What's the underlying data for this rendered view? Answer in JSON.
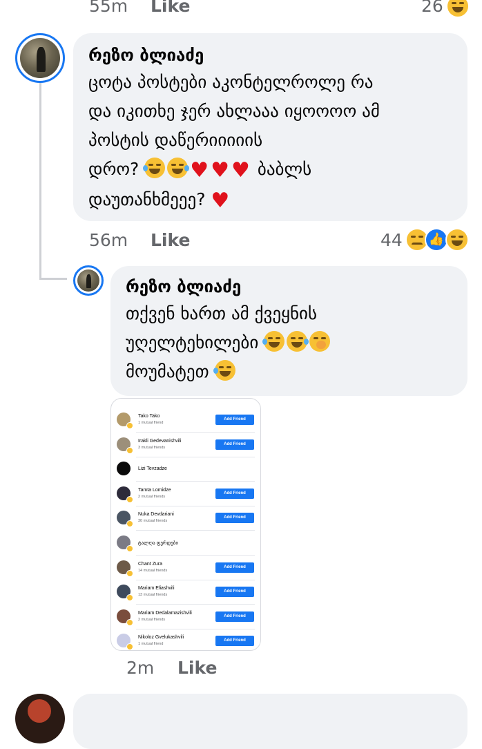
{
  "top_meta": {
    "time": "55m",
    "like": "Like",
    "reaction_count": "26"
  },
  "comment1": {
    "author": "რეზო ბლიაძე",
    "lines": [
      "ცოტა პოსტები აკონტელროლე რა",
      "და იკითხე ჯერ ახლააა იყოოოო ამ",
      "პოსტის დაწერიიიიის"
    ],
    "line4_start": "დრო?",
    "line4_end": "ბაბლს",
    "line5": "დაუთანხმეეე?",
    "time": "56m",
    "like": "Like",
    "reaction_count": "44"
  },
  "reply": {
    "author": "რეზო ბლიაძე",
    "line1": "თქვენ ხართ ამ ქვეყნის",
    "line2": "უღელტეხილები",
    "line3": "მოუმატეთ",
    "time": "2m",
    "like": "Like"
  },
  "friend_list": {
    "button_label": "Add Friend",
    "rows": [
      {
        "name": "Tako Tako",
        "mutual": "1 mutual friend",
        "has_button": true
      },
      {
        "name": "Irakli Gedevanishvili",
        "mutual": "3 mutual friends",
        "has_button": true
      },
      {
        "name": "Lizi Tevzadze",
        "mutual": "",
        "has_button": false
      },
      {
        "name": "Tamta Lomidze",
        "mutual": "2 mutual friends",
        "has_button": true
      },
      {
        "name": "Nuka Devdariani",
        "mutual": "30 mutual friends",
        "has_button": true
      },
      {
        "name": "ტალღა ფერდები",
        "mutual": "",
        "has_button": false
      },
      {
        "name": "Chant Zura",
        "mutual": "14 mutual friends",
        "has_button": true
      },
      {
        "name": "Mariam Eliashvili",
        "mutual": "13 mutual friends",
        "has_button": true
      },
      {
        "name": "Mariam Dedalamazishvili",
        "mutual": "2 mutual friends",
        "has_button": true
      },
      {
        "name": "Nikoloz Gvelukashvili",
        "mutual": "1 mutual friend",
        "has_button": true
      }
    ]
  },
  "colors": {
    "accent": "#1877f2",
    "bubble": "#f0f2f5",
    "meta_text": "#65676b",
    "heart": "#e0121c"
  }
}
